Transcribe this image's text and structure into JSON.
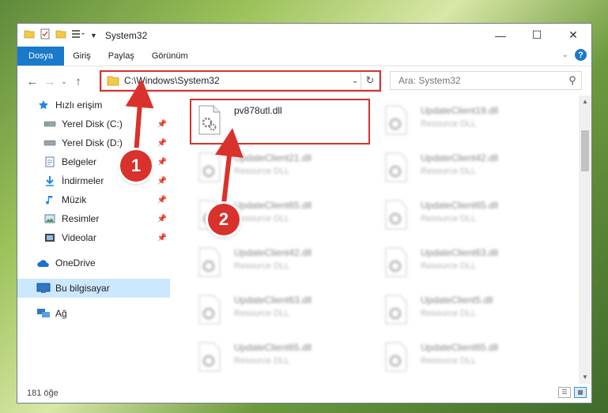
{
  "window": {
    "title": "System32"
  },
  "ribbon": {
    "tabs": [
      {
        "label": "Dosya",
        "active": true
      },
      {
        "label": "Giriş"
      },
      {
        "label": "Paylaş"
      },
      {
        "label": "Görünüm"
      }
    ]
  },
  "address": {
    "path": "C:\\Windows\\System32"
  },
  "search": {
    "placeholder": "Ara: System32"
  },
  "sidebar": {
    "items": [
      {
        "label": "Hızlı erişim",
        "icon": "star-icon"
      },
      {
        "label": "Yerel Disk (C:)",
        "icon": "drive-icon",
        "pinned": true
      },
      {
        "label": "Yerel Disk (D:)",
        "icon": "drive-icon",
        "pinned": true
      },
      {
        "label": "Belgeler",
        "icon": "document-icon",
        "pinned": true
      },
      {
        "label": "İndirmeler",
        "icon": "download-icon",
        "pinned": true
      },
      {
        "label": "Müzik",
        "icon": "music-icon",
        "pinned": true
      },
      {
        "label": "Resimler",
        "icon": "picture-icon",
        "pinned": true
      },
      {
        "label": "Videolar",
        "icon": "video-icon",
        "pinned": true
      },
      {
        "label": "OneDrive",
        "icon": "cloud-icon"
      },
      {
        "label": "Bu bilgisayar",
        "icon": "computer-icon",
        "selected": true
      },
      {
        "label": "Ağ",
        "icon": "network-icon"
      }
    ]
  },
  "files": {
    "highlight": {
      "name": "pv878utl.dll"
    },
    "blurred": [
      {
        "name": "UpdateClient19.dll",
        "type": "Resource DLL"
      },
      {
        "name": "UpdateClient21.dll",
        "type": "Resource DLL"
      },
      {
        "name": "UpdateClient42.dll",
        "type": "Resource DLL"
      },
      {
        "name": "UpdateClient65.dll",
        "type": "Resource DLL"
      },
      {
        "name": "UpdateClient65.dll",
        "type": "Resource DLL"
      },
      {
        "name": "UpdateClient42.dll",
        "type": "Resource DLL"
      },
      {
        "name": "UpdateClient63.dll",
        "type": "Resource DLL"
      },
      {
        "name": "UpdateClient63.dll",
        "type": "Resource DLL"
      },
      {
        "name": "UpdateClient5.dll",
        "type": "Resource DLL"
      },
      {
        "name": "UpdateClient65.dll",
        "type": "Resource DLL"
      },
      {
        "name": "UpdateClient65.dll",
        "type": "Resource DLL"
      }
    ]
  },
  "status": {
    "count": "181 öğe"
  },
  "callouts": [
    "1",
    "2"
  ],
  "colors": {
    "accent": "#1979ca",
    "highlight": "#d9312b",
    "selection": "#cce8ff"
  }
}
